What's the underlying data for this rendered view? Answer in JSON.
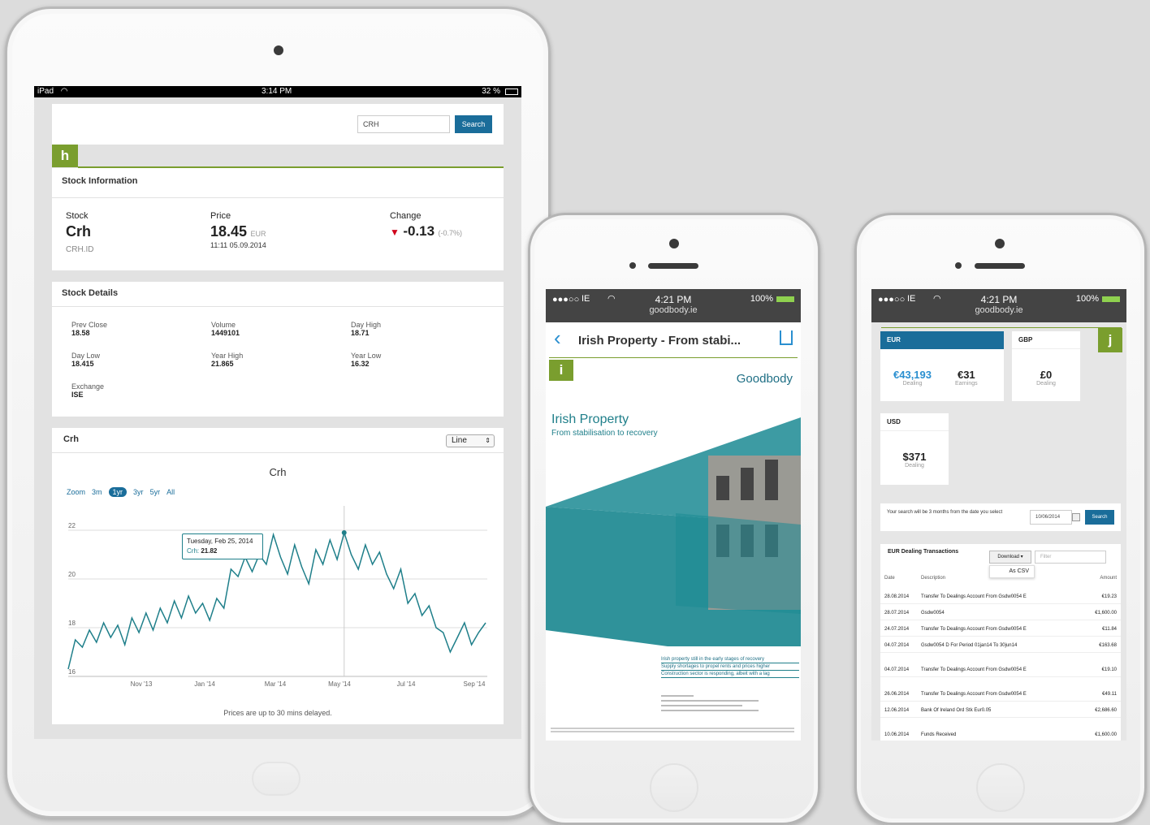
{
  "ipad": {
    "status": {
      "carrier": "iPad",
      "time": "3:14 PM",
      "battery": "32 %"
    },
    "search": {
      "value": "CRH",
      "button": "Search"
    },
    "badge": "h",
    "stock_info": {
      "title": "Stock Information",
      "stock_label": "Stock",
      "stock_name": "Crh",
      "stock_id": "CRH.ID",
      "price_label": "Price",
      "price": "18.45",
      "currency": "EUR",
      "price_time": "11:11 05.09.2014",
      "change_label": "Change",
      "change": "-0.13",
      "change_pct": "(-0.7%)"
    },
    "stock_details": {
      "title": "Stock Details",
      "items": [
        {
          "label": "Prev Close",
          "value": "18.58"
        },
        {
          "label": "Volume",
          "value": "1449101"
        },
        {
          "label": "Day High",
          "value": "18.71"
        },
        {
          "label": "Day Low",
          "value": "18.415"
        },
        {
          "label": "Year High",
          "value": "21.865"
        },
        {
          "label": "Year Low",
          "value": "16.32"
        },
        {
          "label": "Exchange",
          "value": "ISE"
        }
      ]
    },
    "chart_panel": {
      "title": "Crh",
      "select": "Line",
      "chart_title": "Crh",
      "zoom_label": "Zoom",
      "zoom": [
        "3m",
        "1yr",
        "3yr",
        "5yr",
        "All"
      ],
      "tooltip_date": "Tuesday, Feb 25, 2014",
      "tooltip_series": "Crh:",
      "tooltip_value": "21.82",
      "footer": "Prices are up to 30 mins delayed."
    }
  },
  "chart_data": {
    "type": "line",
    "title": "Crh",
    "x_ticks": [
      "Nov '13",
      "Jan '14",
      "Mar '14",
      "May '14",
      "Jul '14",
      "Sep '14"
    ],
    "y_ticks": [
      16,
      18,
      20,
      22
    ],
    "ylim": [
      16,
      23
    ],
    "series": [
      {
        "values": [
          16.3,
          17.5,
          17.2,
          17.9,
          17.4,
          18.2,
          17.6,
          18.1,
          17.3,
          18.4,
          17.8,
          18.6,
          17.9,
          18.8,
          18.2,
          19.1,
          18.4,
          19.3,
          18.6,
          19.0,
          18.3,
          19.2,
          18.8,
          20.4,
          20.1,
          20.9,
          20.3,
          21.0,
          20.6,
          21.82,
          20.9,
          20.2,
          21.4,
          20.5,
          19.8,
          21.2,
          20.6,
          21.6,
          20.8,
          21.9,
          21.0,
          20.4,
          21.4,
          20.6,
          21.1,
          20.2,
          19.6,
          20.4,
          19.0,
          19.4,
          18.5,
          18.9,
          18.0,
          17.8,
          17.0,
          17.6,
          18.2,
          17.3,
          17.8,
          18.2
        ]
      }
    ]
  },
  "iphone1": {
    "status": {
      "carrier": "IE",
      "time": "4:21 PM",
      "url": "goodbody.ie",
      "battery": "100%"
    },
    "nav_title": "Irish Property - From stabi...",
    "badge": "i",
    "logo": "Goodbody",
    "doc_title": "Irish Property",
    "doc_subtitle": "From stabilisation to recovery",
    "bullets": [
      "Irish property still in the early stages of recovery",
      "Supply shortages to propel rents and prices higher",
      "Construction sector is responding, albeit with a lag"
    ]
  },
  "iphone2": {
    "status": {
      "carrier": "IE",
      "time": "4:21 PM",
      "url": "goodbody.ie",
      "battery": "100%"
    },
    "badge": "j",
    "eur": {
      "tab": "EUR",
      "dealing": "€43,193",
      "dealing_label": "Dealing",
      "earnings": "€31",
      "earnings_label": "Earnings"
    },
    "gbp": {
      "tab": "GBP",
      "dealing": "£0",
      "dealing_label": "Dealing"
    },
    "usd": {
      "tab": "USD",
      "dealing": "$371",
      "dealing_label": "Dealing"
    },
    "search_text": "Your search will be 3 months from the date you select",
    "search_date": "10/06/2014",
    "search_button": "Search",
    "transactions": {
      "title": "EUR Dealing Transactions",
      "download": "Download ▾",
      "filter_placeholder": "Filter",
      "dropdown_item": "As CSV",
      "columns": [
        "Date",
        "Description",
        "Amount"
      ],
      "rows": [
        {
          "date": "28.08.2014",
          "desc": "Transfer To Dealings Account From Gsdw0054 E",
          "amount": "€19.23"
        },
        {
          "date": "28.07.2014",
          "desc": "Gsdw0054",
          "amount": "€1,600.00"
        },
        {
          "date": "24.07.2014",
          "desc": "Transfer To Dealings Account From Gsdw0054 E",
          "amount": "€11.84"
        },
        {
          "date": "04.07.2014",
          "desc": "Gsdw0054 D For Period 01jan14 To 30jun14",
          "amount": "€163.68"
        },
        {
          "date": "04.07.2014",
          "desc": "Transfer To Dealings Account From Gsdw0054 E",
          "amount": "€19.10"
        },
        {
          "date": "26.06.2014",
          "desc": "Transfer To Dealings Account From Gsdw0054 E",
          "amount": "€49.11"
        },
        {
          "date": "12.06.2014",
          "desc": "Bank Of Ireland Ord Stk Eur0.05",
          "amount": "€2,686.60"
        },
        {
          "date": "10.06.2014",
          "desc": "Funds Received",
          "amount": "€1,600.00"
        }
      ]
    }
  }
}
